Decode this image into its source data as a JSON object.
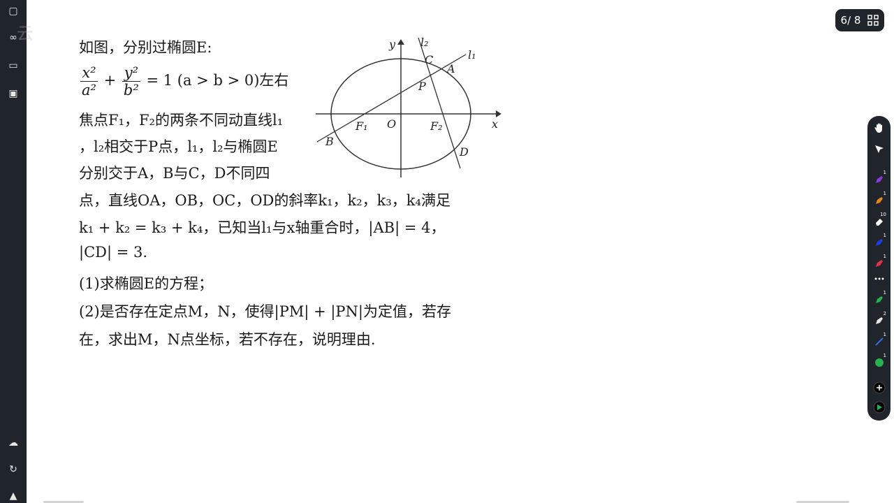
{
  "page_indicator": {
    "label": "6/ 8"
  },
  "watermark": {
    "text": "云"
  },
  "problem": {
    "l1": "如图，分别过椭圆E:",
    "l2_tail": "左右",
    "l3": "焦点F₁，F₂的两条不同动直线l₁",
    "l4": "，l₂相交于P点，l₁，l₂与椭圆E",
    "l5": "分别交于A，B与C，D不同四",
    "l6": "点，直线OA，OB，OC，OD的斜率k₁，k₂，k₃，k₄满足",
    "l7": "k₁ + k₂ = k₃ + k₄，已知当l₁与x轴重合时，|AB| = 4，",
    "l8": "|CD| = 3.",
    "l9": "(1)求椭圆E的方程；",
    "l10": "(2)是否存在定点M，N，使得|PM| + |PN|为定值，若存",
    "l11": "在，求出M，N点坐标，若不存在，说明理由."
  },
  "equation": {
    "num1": "x²",
    "den1": "a²",
    "num2": "y²",
    "den2": "b²",
    "rest": "= 1 (a > b > 0)"
  },
  "diagram_labels": {
    "y": "y",
    "x": "x",
    "O": "O",
    "F1": "F₁",
    "F2": "F₂",
    "A": "A",
    "B": "B",
    "C": "C",
    "D": "D",
    "P": "P",
    "l1": "l₁",
    "l2": "l₂"
  },
  "right_toolbar": [
    {
      "name": "hand-icon",
      "badge": ""
    },
    {
      "name": "pointer-icon",
      "badge": ""
    },
    {
      "name": "purple-pen-icon",
      "badge": "1",
      "color": "#8a3ad6"
    },
    {
      "name": "orange-pen-icon",
      "badge": "1",
      "color": "#e9861b"
    },
    {
      "name": "eraser-icon",
      "badge": "10"
    },
    {
      "name": "blue-pen-icon",
      "badge": "1",
      "color": "#1f3de6"
    },
    {
      "name": "red-pen-icon",
      "badge": "1",
      "color": "#e0304a"
    },
    {
      "name": "more-icon",
      "badge": ""
    },
    {
      "name": "green-pen-icon",
      "badge": "1",
      "color": "#26b24d"
    },
    {
      "name": "white-pen-icon",
      "badge": "2",
      "color": "#e8e8e8"
    },
    {
      "name": "line-tool-icon",
      "badge": "1",
      "color": "#2b6fe0"
    },
    {
      "name": "green-circle-icon",
      "badge": "1",
      "color": "#26b24d"
    },
    {
      "name": "add-icon",
      "badge": ""
    },
    {
      "name": "forward-icon",
      "badge": ""
    }
  ]
}
